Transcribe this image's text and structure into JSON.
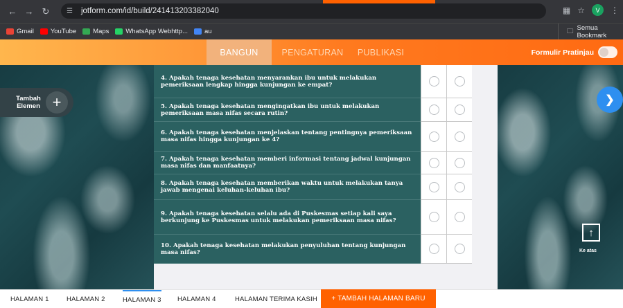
{
  "browser": {
    "url": "jotform.com/id/build/241413203382040",
    "avatar_letter": "V"
  },
  "bookmarks": [
    {
      "label": "Gmail",
      "color": "#ea4335"
    },
    {
      "label": "YouTube",
      "color": "#ff0000"
    },
    {
      "label": "Maps",
      "color": "#34a853"
    },
    {
      "label": "WhatsApp Webhttp...",
      "color": "#25d366"
    },
    {
      "label": "au",
      "color": "#4285f4"
    }
  ],
  "bookmarks_right": "Semua Bookmark",
  "nav": {
    "tabs": [
      "BANGUN",
      "PENGATURAN",
      "PUBLIKASI"
    ],
    "preview_label": "Formulir Pratinjau"
  },
  "left_panel": {
    "add_label": "Tambah Elemen",
    "plus": "+"
  },
  "questions": [
    "4. Apakah tenaga kesehatan menyarankan ibu untuk melakukan pemeriksaan lengkap hingga kunjungan ke empat?",
    "5. Apakah tenaga kesehatan mengingatkan ibu untuk melakukan pemeriksaan masa nifas secara rutin?",
    "6. Apakah tenaga kesehatan menjelaskan tentang pentingnya pemeriksaan masa nifas hingga kunjungan ke 4?",
    "7. Apakah tenaga kesehatan memberi informasi tentang jadwal kunjungan masa nifas dan manfaatnya?",
    "8. Apakah tenaga kesehatan memberikan waktu untuk melakukan tanya jawab mengenai keluhan-keluhan ibu?",
    "9. Apakah tenaga kesehatan selalu ada di Puskesmas setiap kali saya berkunjung ke Puskesmas untuk melakukan pemeriksaan masa nifas?",
    "10. Apakah tenaga kesehatan melakukan penyuluhan tentang kunjungan masa nifas?"
  ],
  "right_panel": {
    "paint_icon": "paint-roller-icon",
    "up_label": "Ke atas"
  },
  "pages": [
    "HALAMAN 1",
    "HALAMAN 2",
    "HALAMAN 3",
    "HALAMAN 4",
    "HALAMAN TERIMA KASIH"
  ],
  "add_page": "+ TAMBAH HALAMAN BARU"
}
